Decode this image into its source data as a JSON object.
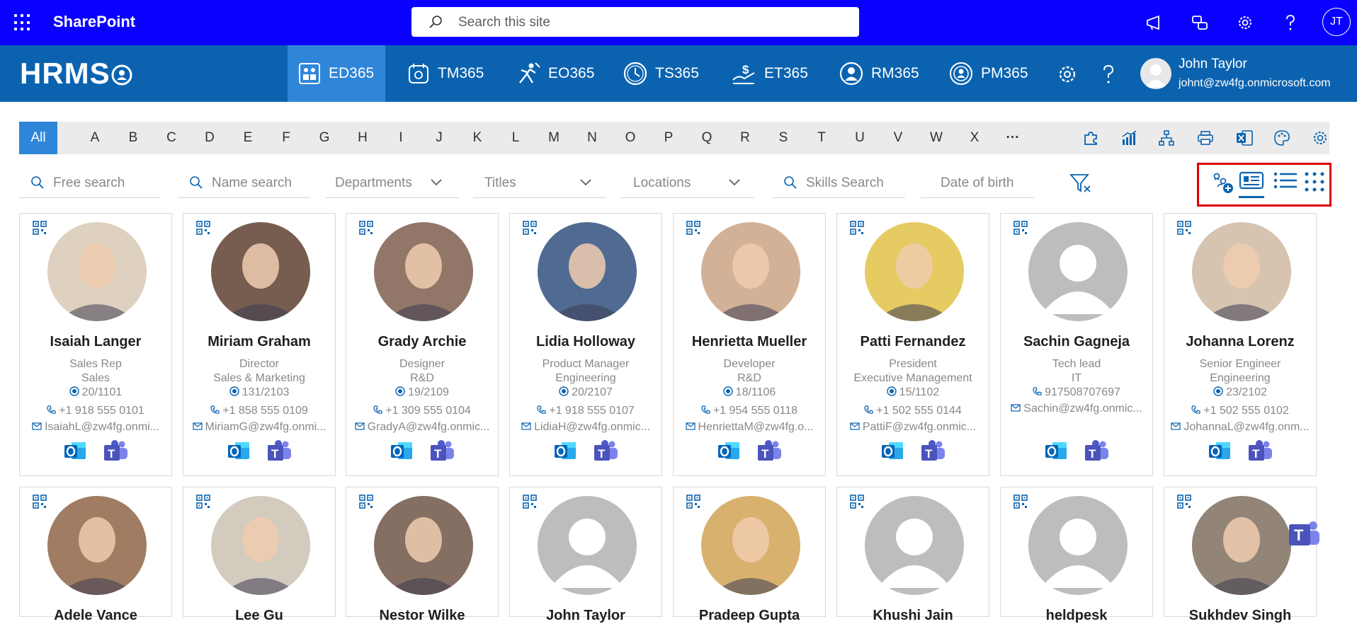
{
  "suitebar": {
    "title": "SharePoint",
    "search_placeholder": "Search this site",
    "user_initials": "JT"
  },
  "hrms": {
    "logo": "HRMS",
    "tabs": [
      {
        "label": "ED365",
        "icon": "employee-directory-icon",
        "active": true
      },
      {
        "label": "TM365",
        "icon": "time-management-icon",
        "active": false
      },
      {
        "label": "EO365",
        "icon": "onboarding-icon",
        "active": false
      },
      {
        "label": "TS365",
        "icon": "timesheet-icon",
        "active": false
      },
      {
        "label": "ET365",
        "icon": "expense-icon",
        "active": false
      },
      {
        "label": "RM365",
        "icon": "recruitment-icon",
        "active": false
      },
      {
        "label": "PM365",
        "icon": "performance-icon",
        "active": false
      }
    ],
    "user": {
      "name": "John Taylor",
      "email": "johnt@zw4fg.onmicrosoft.com"
    }
  },
  "alphabet": [
    "All",
    "A",
    "B",
    "C",
    "D",
    "E",
    "F",
    "G",
    "H",
    "I",
    "J",
    "K",
    "L",
    "M",
    "N",
    "O",
    "P",
    "Q",
    "R",
    "S",
    "T",
    "U",
    "V",
    "W",
    "X",
    "···"
  ],
  "filters": {
    "free_search": "Free search",
    "name_search": "Name search",
    "departments": "Departments",
    "titles": "Titles",
    "locations": "Locations",
    "skills_search": "Skills Search",
    "date_of_birth": "Date of birth"
  },
  "cards": [
    {
      "name": "Isaiah Langer",
      "title": "Sales Rep",
      "department": "Sales",
      "location": "20/1101",
      "phone": "+1 918 555 0101",
      "email": "IsaiahL@zw4fg.onmi..."
    },
    {
      "name": "Miriam Graham",
      "title": "Director",
      "department": "Sales & Marketing",
      "location": "131/2103",
      "phone": "+1 858 555 0109",
      "email": "MiriamG@zw4fg.onmi..."
    },
    {
      "name": "Grady Archie",
      "title": "Designer",
      "department": "R&D",
      "location": "19/2109",
      "phone": "+1 309 555 0104",
      "email": "GradyA@zw4fg.onmic..."
    },
    {
      "name": "Lidia Holloway",
      "title": "Product Manager",
      "department": "Engineering",
      "location": "20/2107",
      "phone": "+1 918 555 0107",
      "email": "LidiaH@zw4fg.onmic..."
    },
    {
      "name": "Henrietta Mueller",
      "title": "Developer",
      "department": "R&D",
      "location": "18/1106",
      "phone": "+1 954 555 0118",
      "email": "HenriettaM@zw4fg.o..."
    },
    {
      "name": "Patti Fernandez",
      "title": "President",
      "department": "Executive Management",
      "location": "15/1102",
      "phone": "+1 502 555 0144",
      "email": "PattiF@zw4fg.onmic..."
    },
    {
      "name": "Sachin Gagneja",
      "title": "Tech lead",
      "department": "IT",
      "location": "",
      "phone": "917508707697",
      "email": "Sachin@zw4fg.onmic..."
    },
    {
      "name": "Johanna Lorenz",
      "title": "Senior Engineer",
      "department": "Engineering",
      "location": "23/2102",
      "phone": "+1 502 555 0102",
      "email": "JohannaL@zw4fg.onm..."
    },
    {
      "name": "Adele Vance"
    },
    {
      "name": "Lee Gu"
    },
    {
      "name": "Nestor Wilke"
    },
    {
      "name": "John Taylor"
    },
    {
      "name": "Pradeep Gupta"
    },
    {
      "name": "Khushi Jain"
    },
    {
      "name": "heldpesk"
    },
    {
      "name": "Sukhdev Singh"
    }
  ],
  "colors": {
    "suitebar": "#0a00ff",
    "hrms_header": "#0b63b0",
    "active_tab": "#2f86d9",
    "accent": "#0b63b0",
    "highlight_box": "#e00000"
  }
}
